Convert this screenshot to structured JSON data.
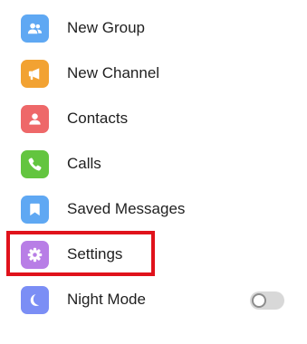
{
  "menu": {
    "items": [
      {
        "label": "New Group",
        "icon": "people-icon",
        "color": "#5fa8f3"
      },
      {
        "label": "New Channel",
        "icon": "megaphone-icon",
        "color": "#f2a232"
      },
      {
        "label": "Contacts",
        "icon": "person-icon",
        "color": "#ee6869"
      },
      {
        "label": "Calls",
        "icon": "phone-icon",
        "color": "#63c53f"
      },
      {
        "label": "Saved Messages",
        "icon": "bookmark-icon",
        "color": "#5fa8f3"
      },
      {
        "label": "Settings",
        "icon": "gear-icon",
        "color": "#b87ee6"
      },
      {
        "label": "Night Mode",
        "icon": "moon-icon",
        "color": "#7b8ef5"
      }
    ],
    "night_mode_enabled": false,
    "highlight_color": "#e0121b"
  }
}
